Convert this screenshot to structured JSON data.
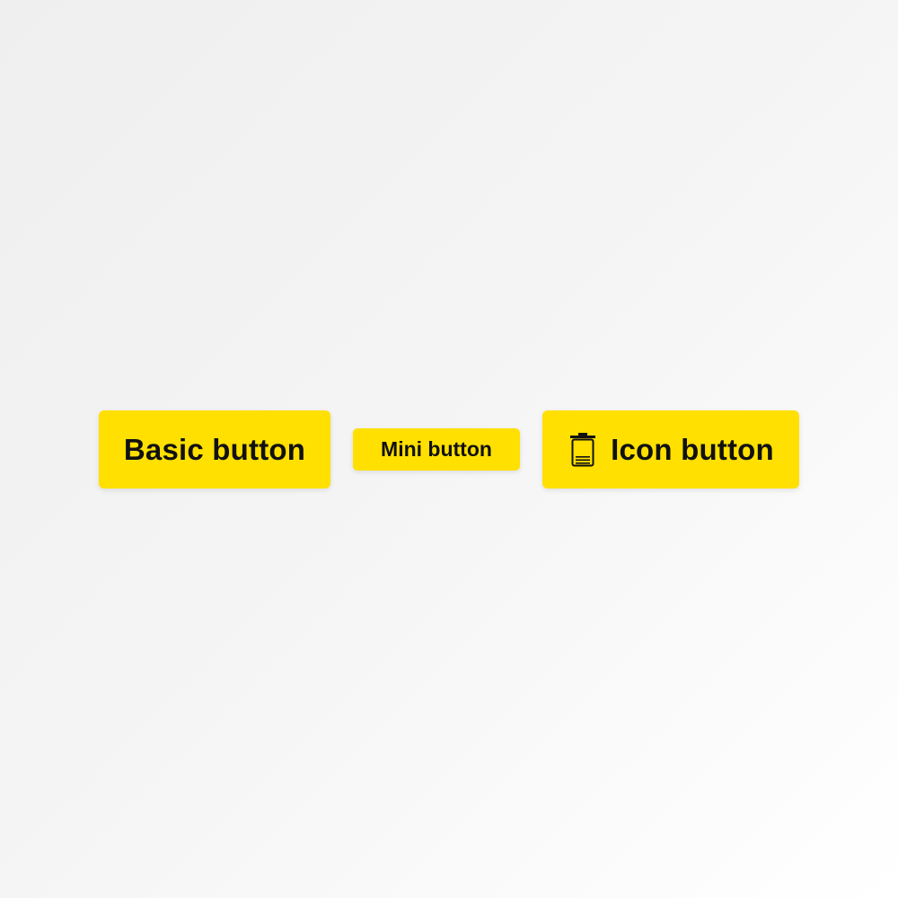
{
  "buttons": {
    "basic_label": "Basic button",
    "mini_label": "Mini button",
    "icon_label": "Icon button",
    "icon_name": "trash-icon"
  },
  "colors": {
    "button_bg": "#ffe000",
    "button_text": "#111111",
    "background": "#f2f2f2"
  }
}
